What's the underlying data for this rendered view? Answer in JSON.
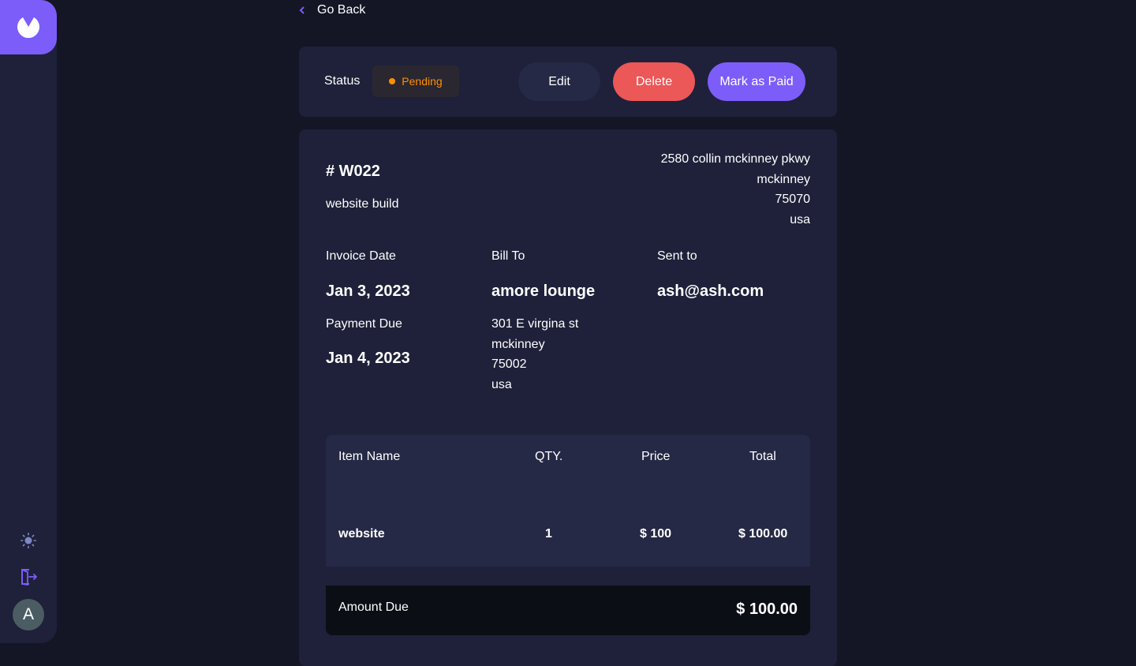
{
  "sidebar": {
    "avatar_initial": "A",
    "icons": {
      "logo": "logo-icon",
      "theme": "sun-icon",
      "logout": "logout-icon"
    }
  },
  "nav": {
    "go_back_label": "Go Back"
  },
  "status_bar": {
    "label": "Status",
    "status": "Pending",
    "edit_label": "Edit",
    "delete_label": "Delete",
    "mark_paid_label": "Mark as Paid"
  },
  "invoice": {
    "id": "# W022",
    "description": "website build",
    "sender_address": {
      "street": "2580 collin mckinney pkwy",
      "city": "mckinney",
      "post_code": "75070",
      "country": "usa"
    },
    "invoice_date_label": "Invoice Date",
    "invoice_date": "Jan 3, 2023",
    "payment_due_label": "Payment Due",
    "payment_due": "Jan 4, 2023",
    "bill_to_label": "Bill To",
    "client_name": "amore lounge",
    "client_address": {
      "street": "301 E virgina st",
      "city": "mckinney",
      "post_code": "75002",
      "country": "usa"
    },
    "sent_to_label": "Sent to",
    "client_email": "ash@ash.com",
    "items_table": {
      "headers": [
        "Item Name",
        "QTY.",
        "Price",
        "Total"
      ],
      "rows": [
        {
          "name": "website",
          "qty": "1",
          "price": "$ 100",
          "total": "$ 100.00"
        }
      ]
    },
    "amount_due_label": "Amount Due",
    "amount_due": "$ 100.00"
  },
  "colors": {
    "accent": "#7c5dfa",
    "danger": "#ec5757",
    "pending": "#ff8f00",
    "background": "#141625",
    "card": "#1e2139"
  }
}
